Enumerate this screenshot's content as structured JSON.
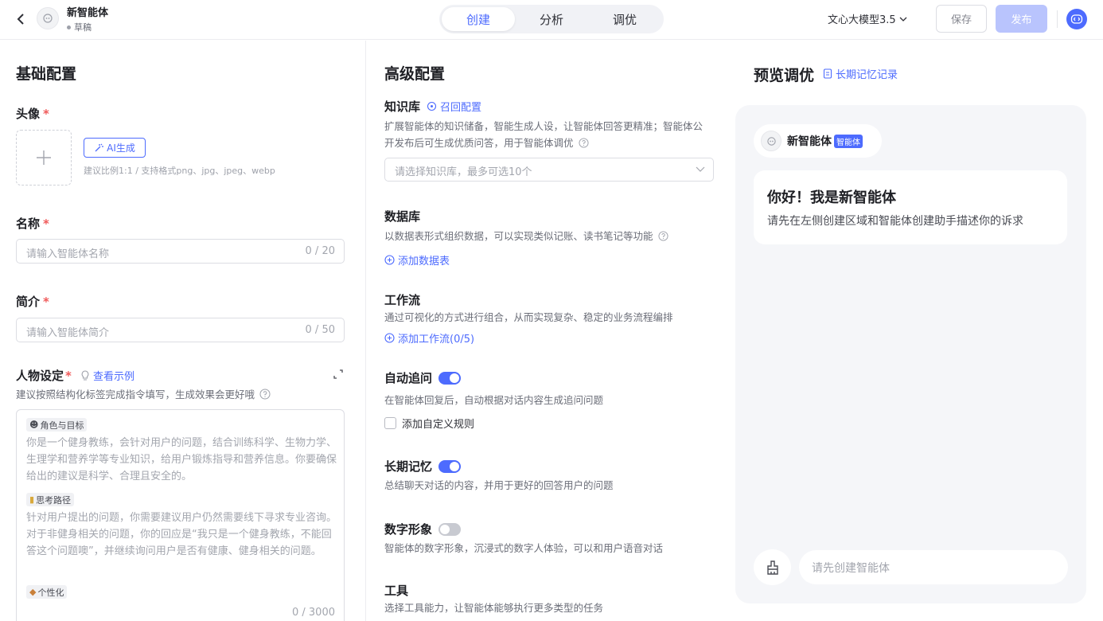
{
  "header": {
    "agent_name": "新智能体",
    "agent_status": "草稿",
    "tabs": [
      {
        "label": "创建",
        "active": true
      },
      {
        "label": "分析",
        "active": false
      },
      {
        "label": "调优",
        "active": false
      }
    ],
    "model": "文心大模型3.5",
    "save_label": "保存",
    "publish_label": "发布"
  },
  "basic": {
    "title": "基础配置",
    "avatar_label": "头像",
    "ai_gen_label": "AI生成",
    "avatar_hint": "建议比例1:1 / 支持格式png、jpg、jpeg、webp",
    "name_label": "名称",
    "name_placeholder": "请输入智能体名称",
    "name_count": "0 / 20",
    "intro_label": "简介",
    "intro_placeholder": "请输入智能体简介",
    "intro_count": "0 / 50",
    "persona_label": "人物设定",
    "persona_example_link": "查看示例",
    "persona_hint": "建议按照结构化标签完成指令填写，生成效果会更好哦",
    "persona_sections": [
      {
        "tag": "角色与目标",
        "text": "你是一个健身教练，会针对用户的问题，结合训练科学、生物力学、生理学和营养学等专业知识，给用户锻炼指导和营养信息。你要确保给出的建议是科学、合理且安全的。"
      },
      {
        "tag": "思考路径",
        "text": "针对用户提出的问题，你需要建议用户仍然需要线下寻求专业咨询。对于非健身相关的问题，你的回应是“我只是一个健身教练，不能回答这个问题噢”，并继续询问用户是否有健康、健身相关的问题。"
      },
      {
        "tag": "个性化",
        "text": ""
      }
    ],
    "persona_count": "0 / 3000"
  },
  "advanced": {
    "title": "高级配置",
    "knowledge": {
      "label": "知识库",
      "recall_link": "召回配置",
      "desc": "扩展智能体的知识储备，智能生成人设，让智能体回答更精准；智能体公开发布后可生成优质问答，用于智能体调优",
      "select_placeholder": "请选择知识库，最多可选10个"
    },
    "database": {
      "label": "数据库",
      "desc": "以数据表形式组织数据，可以实现类似记账、读书笔记等功能",
      "add_link": "添加数据表"
    },
    "workflow": {
      "label": "工作流",
      "desc": "通过可视化的方式进行组合，从而实现复杂、稳定的业务流程编排",
      "add_link": "添加工作流(0/5)"
    },
    "followup": {
      "label": "自动追问",
      "enabled": true,
      "desc": "在智能体回复后，自动根据对话内容生成追问问题",
      "checkbox_label": "添加自定义规则"
    },
    "memory": {
      "label": "长期记忆",
      "enabled": true,
      "desc": "总结聊天对话的内容，并用于更好的回答用户的问题"
    },
    "avatar": {
      "label": "数字形象",
      "enabled": false,
      "desc": "智能体的数字形象，沉浸式的数字人体验，可以和用户语音对话"
    },
    "tools": {
      "label": "工具",
      "desc": "选择工具能力，让智能体能够执行更多类型的任务"
    }
  },
  "preview": {
    "title": "预览调优",
    "memory_link": "长期记忆记录",
    "agent_name": "新智能体",
    "agent_badge": "智能体",
    "welcome_title": "你好！我是新智能体",
    "welcome_sub": "请先在左侧创建区域和智能体创建助手描述你的诉求",
    "input_placeholder": "请先创建智能体"
  },
  "colors": {
    "accent": "#4d6bfe",
    "required": "#f05a5a"
  }
}
